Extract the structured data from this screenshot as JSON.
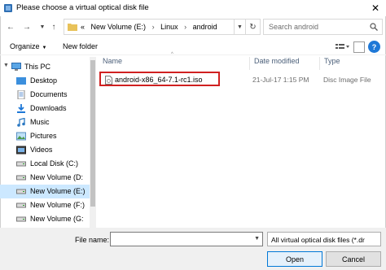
{
  "window": {
    "title": "Please choose a virtual optical disk file"
  },
  "address": {
    "overflow": "«",
    "crumbs": [
      "New Volume (E:)",
      "Linux",
      "android"
    ],
    "separator": "›"
  },
  "search": {
    "placeholder": "Search android"
  },
  "toolbar": {
    "organize_label": "Organize",
    "new_folder_label": "New folder"
  },
  "nav": {
    "items": [
      {
        "label": "This PC",
        "icon": "computer-icon"
      },
      {
        "label": "Desktop",
        "icon": "desktop-folder-icon"
      },
      {
        "label": "Documents",
        "icon": "documents-folder-icon"
      },
      {
        "label": "Downloads",
        "icon": "downloads-folder-icon"
      },
      {
        "label": "Music",
        "icon": "music-folder-icon"
      },
      {
        "label": "Pictures",
        "icon": "pictures-folder-icon"
      },
      {
        "label": "Videos",
        "icon": "videos-folder-icon"
      },
      {
        "label": "Local Disk (C:)",
        "icon": "drive-icon"
      },
      {
        "label": "New Volume (D:",
        "icon": "drive-icon"
      },
      {
        "label": "New Volume (E:)",
        "icon": "drive-icon",
        "selected": true
      },
      {
        "label": "New Volume (F:)",
        "icon": "drive-icon"
      },
      {
        "label": "New Volume (G:",
        "icon": "drive-icon"
      }
    ]
  },
  "columns": {
    "name": "Name",
    "date": "Date modified",
    "type": "Type"
  },
  "files": [
    {
      "name": "android-x86_64-7.1-rc1.iso",
      "date": "21-Jul-17 1:15 PM",
      "type": "Disc Image File"
    }
  ],
  "footer": {
    "file_name_label": "File name:",
    "file_name_value": "",
    "filter_value": "All virtual optical disk files (*.dr",
    "open_label": "Open",
    "cancel_label": "Cancel"
  },
  "colors": {
    "selection": "#cce8ff",
    "highlight_box": "#d02020",
    "accent": "#0078d7"
  }
}
